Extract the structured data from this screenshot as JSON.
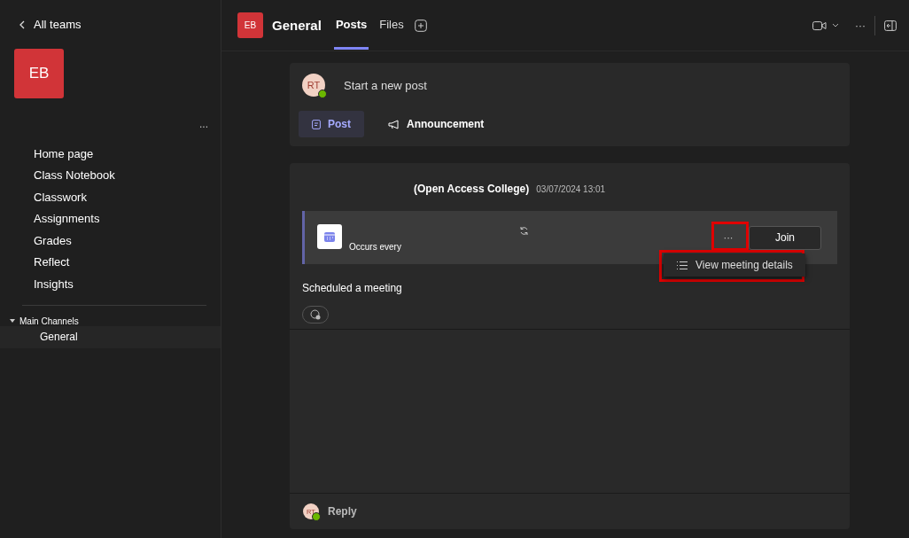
{
  "sidebar": {
    "back_label": "All teams",
    "team_initials": "EB",
    "more": "...",
    "items": [
      {
        "label": "Home page",
        "selected": false
      },
      {
        "label": "Class Notebook",
        "selected": false
      },
      {
        "label": "Classwork",
        "selected": false
      },
      {
        "label": "Assignments",
        "selected": false
      },
      {
        "label": "Grades",
        "selected": false
      },
      {
        "label": "Reflect",
        "selected": false
      },
      {
        "label": "Insights",
        "selected": false
      }
    ],
    "channel_group": {
      "label": "Main Channels",
      "expanded": true,
      "channels": [
        {
          "label": "General",
          "selected": true
        }
      ]
    }
  },
  "header": {
    "team_initials": "EB",
    "channel": "General",
    "tabs": [
      {
        "label": "Posts",
        "selected": true
      },
      {
        "label": "Files",
        "selected": false
      }
    ],
    "more": "···"
  },
  "compose": {
    "avatar": "RT",
    "placeholder": "Start a new post",
    "modes": [
      {
        "label": "Post",
        "selected": true
      },
      {
        "label": "Announcement",
        "selected": false
      }
    ]
  },
  "post": {
    "author": "(Open Access College)",
    "timestamp": "03/07/2024 13:01",
    "meeting": {
      "recurrence": "Occurs every",
      "more": "···",
      "more_highlighted": true,
      "join": "Join"
    },
    "menu": {
      "item": "View meeting details",
      "highlighted": true
    },
    "message": "Scheduled a meeting",
    "reply": {
      "avatar": "RT",
      "label": "Reply"
    }
  }
}
